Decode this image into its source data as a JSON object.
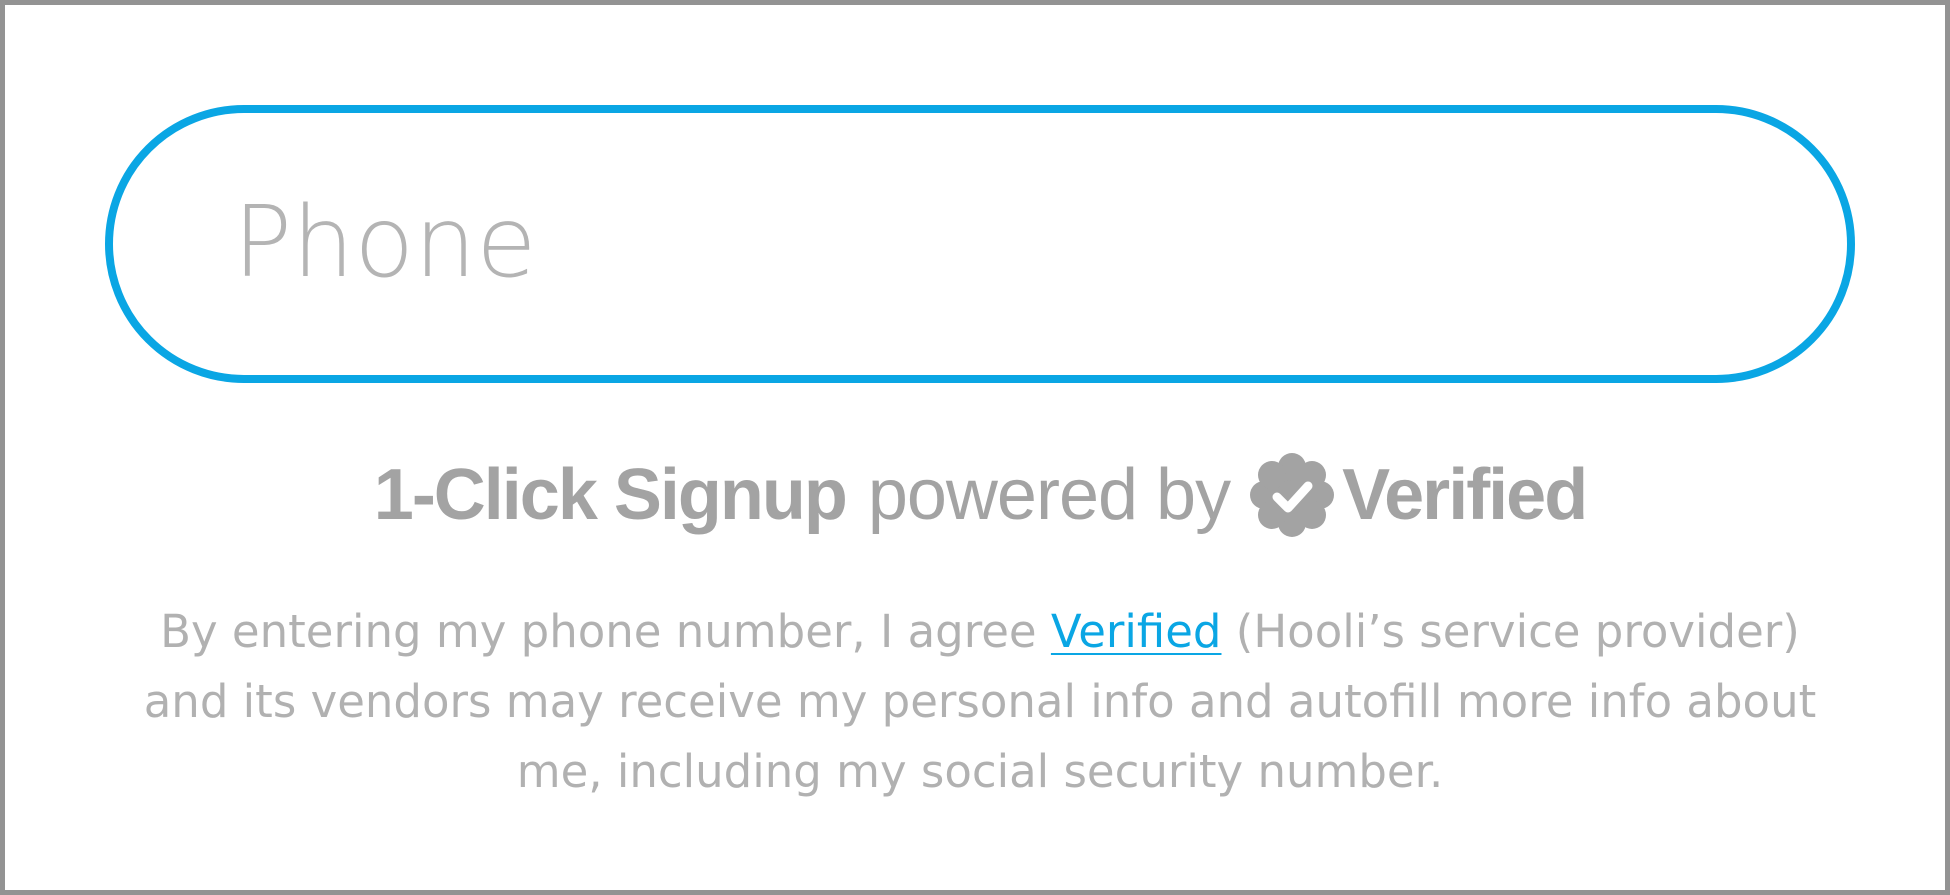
{
  "phone_field": {
    "placeholder": "Phone",
    "value": ""
  },
  "signup": {
    "bold_label": "1-Click Signup",
    "powered_by": "powered by",
    "brand_name": "Verified",
    "badge_icon": "verified-badge-check-icon"
  },
  "disclaimer": {
    "text_before": "By entering my phone number, I agree ",
    "link_text": "Verified",
    "text_after": " (Hooli’s service provider) and its vendors may receive my personal info and autofill more info about me, including my social security number."
  },
  "colors": {
    "accent": "#0aa6e4",
    "text_gray": "#a3a3a3",
    "placeholder_gray": "#b4b4b4",
    "frame_border": "#939393",
    "background": "#ffffff"
  }
}
